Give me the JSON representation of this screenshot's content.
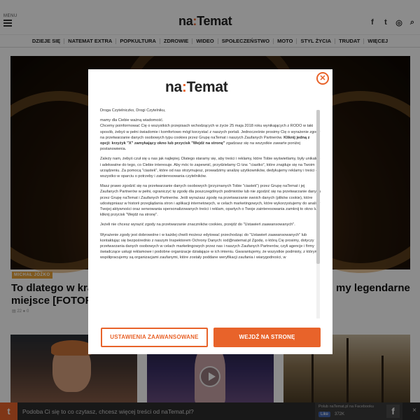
{
  "header": {
    "menu_label": "MENU",
    "logo_main": "na",
    "logo_colon": ":",
    "logo_end": "Temat",
    "icons": [
      "facebook-icon",
      "twitter-icon",
      "instagram-icon",
      "search-icon"
    ],
    "icon_glyphs": {
      "facebook": "f",
      "twitter": "t",
      "instagram": "◎",
      "search": "⌕"
    }
  },
  "nav": {
    "items": [
      "DZIEJE SIĘ",
      "NATEMAT EXTRA",
      "POPKULTURA",
      "ZDROWIE",
      "WIDEO",
      "SPOŁECZEŃSTWO",
      "MOTO",
      "STYL ŻYCIA",
      "TRUDAT",
      "WIĘCEJ"
    ]
  },
  "hero": {
    "tag": "MICHAŁ JÓŻKO",
    "title_left": "To dlatego w kra miejsce [FOTOR",
    "title_right": "my legendarne",
    "meta": "▤ 22  ● 0"
  },
  "fb_bar": {
    "logo": "t",
    "text": "Podoba Ci się to co czytasz, chcesz więcej treści od naTemat.pl?",
    "pane_label": "Polub naTemat.pl na Facebooku",
    "like_label": "Like",
    "like_count": "372K",
    "fb_icon": "f",
    "close": "×"
  },
  "modal": {
    "close": "✕",
    "logo_main": "na",
    "logo_colon": ":",
    "logo_end": "Temat",
    "p1": "Droga Czytelniczko, Drogi Czytelniku,",
    "p2a": "mamy dla Ciebie ważną wiadomość.",
    "p2b": "Chcemy poinformować Cię o wszystkich przepisach wchodzących w życie 25 maja 2018 roku wynikających z RODO w taki sposób, żebyś w pełni świadomie i komfortowo mógł korzystać z naszych portali. Jednocześnie prosimy Cię o wyrażenie zgody na przetwarzanie danych osobowych typu cookies przez Grupę naTemat i naszych Zaufanych Partnerów.",
    "p2bold": "Kliknij jedną z opcji: krzyżyk \"X\" zamykający okno lub przycisk \"Wejdź na stronę\"",
    "p2c": "zgadzasz się na wszystkie zawarte poniżej postanowienia.",
    "p3": "Zależy nam, żebyś czuł się u nas jak najlepiej. Dlatego staramy się, aby treści i reklamy, które Tobie wyświetlamy, były unikalne i adekwatne do tego, co Ciebie interesuje. Aby móc to zapewnić, przydzielamy Ci tzw. \"ciastko\", które znajduje się na Twoim urządzeniu. Za pomocą \"ciastek\", które od nas otrzymujesz, prowadzimy analizę użytkowników, dedykujemy reklamy i treści - wszystko w oparciu o potrzeby i zainteresowania czytelników.",
    "p4": "Masz prawo zgodzić się na przetwarzanie danych osobowych (przyznanych Tobie \"ciastek\") przez Grupę naTemat i jej Zaufanych Partnerów w pełni, ograniczyć tę zgodę dla poszczególnych podmiotów lub nie zgodzić się na przetwarzanie danych przez Grupę naTemat i Zaufanych Partnerów. Jeśli wyrażasz zgodę na przetwarzanie swoich danych (plików cookie), które udostępniasz w historii przeglądania stron i aplikacji internetowych, w celach marketingowych, które wykorzystujemy do analizy Twojej aktywności oraz serwowania spersonalizowanych treści i reklam, opartych o Twoje zainteresowania zamknij to okno lub kliknij przycisk \"Wejdź na stronę\".",
    "p5": "Jeżeli nie chcesz wyrazić zgody na przetwarzanie znaczników cookies, przejdź do \"Ustawień zaawansowanych\".",
    "p6": "Wyrażenie zgody jest dobrowolne i w każdej chwili możesz edytować przechodząc do \"Ustawień zaawansowanych\" lub kontaktując się bezpośrednio z naszym Inspektorem Ochrony Danych: iod@natemat.pl Zgodę, o którą Cię prosimy, dotyczy przetwarzania danych osobowych w celach marketingowych przez nas i naszych Zaufanych Partnerów, czyli agencje i firmy świadczące usługi reklamowe i podobne organizacje działające w ich imieniu. Gwarantujemy, że wszystkie podmioty, z którymi współpracujemy są organizacjami zaufanymi, które zostały poddane weryfikacji zaufania i wiarygodności, w",
    "btn_advanced": "USTAWIENIA ZAAWANSOWANE",
    "btn_enter": "WEJDŹ NA STRONĘ"
  },
  "colors": {
    "accent": "#e8632a",
    "overlay": "rgba(0,0,0,0.45)"
  }
}
